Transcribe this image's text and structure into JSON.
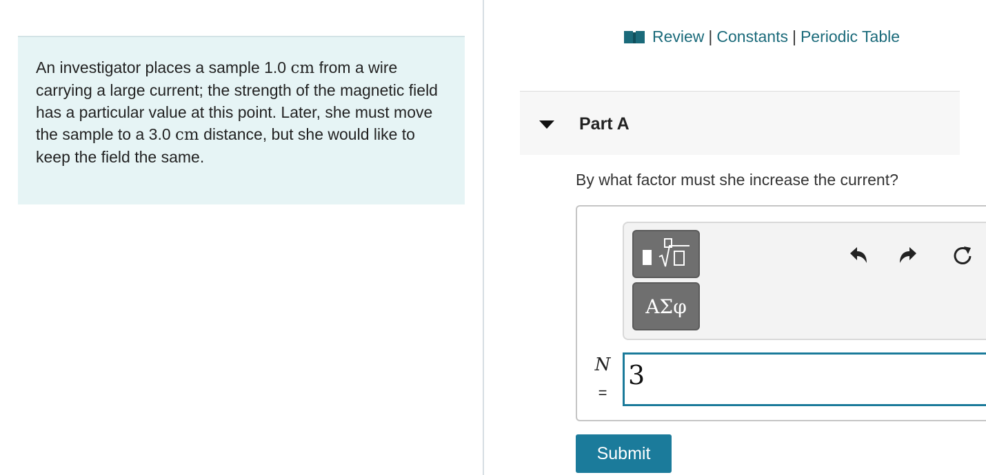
{
  "problem": {
    "text_part1": "An investigator places a sample 1.0 ",
    "unit1": "cm",
    "text_part2": " from a wire carrying a large current; the strength of the magnetic field has a particular value at this point. Later, she must move the sample to a 3.0 ",
    "unit2": "cm",
    "text_part3": " distance, but she would like to keep the field the same."
  },
  "resources": {
    "review": "Review",
    "constants": "Constants",
    "periodic_table": "Periodic Table",
    "separator": "|"
  },
  "part": {
    "title": "Part A",
    "question": "By what factor must she increase the current?"
  },
  "answer": {
    "symbols_label": "ΑΣφ",
    "variable": "N",
    "equals": "=",
    "value": "3"
  },
  "submit_label": "Submit",
  "colors": {
    "link": "#1a6a7a",
    "problem_bg": "#e6f4f5",
    "submit_bg": "#1b7b9b",
    "input_border": "#1a7a9a"
  }
}
